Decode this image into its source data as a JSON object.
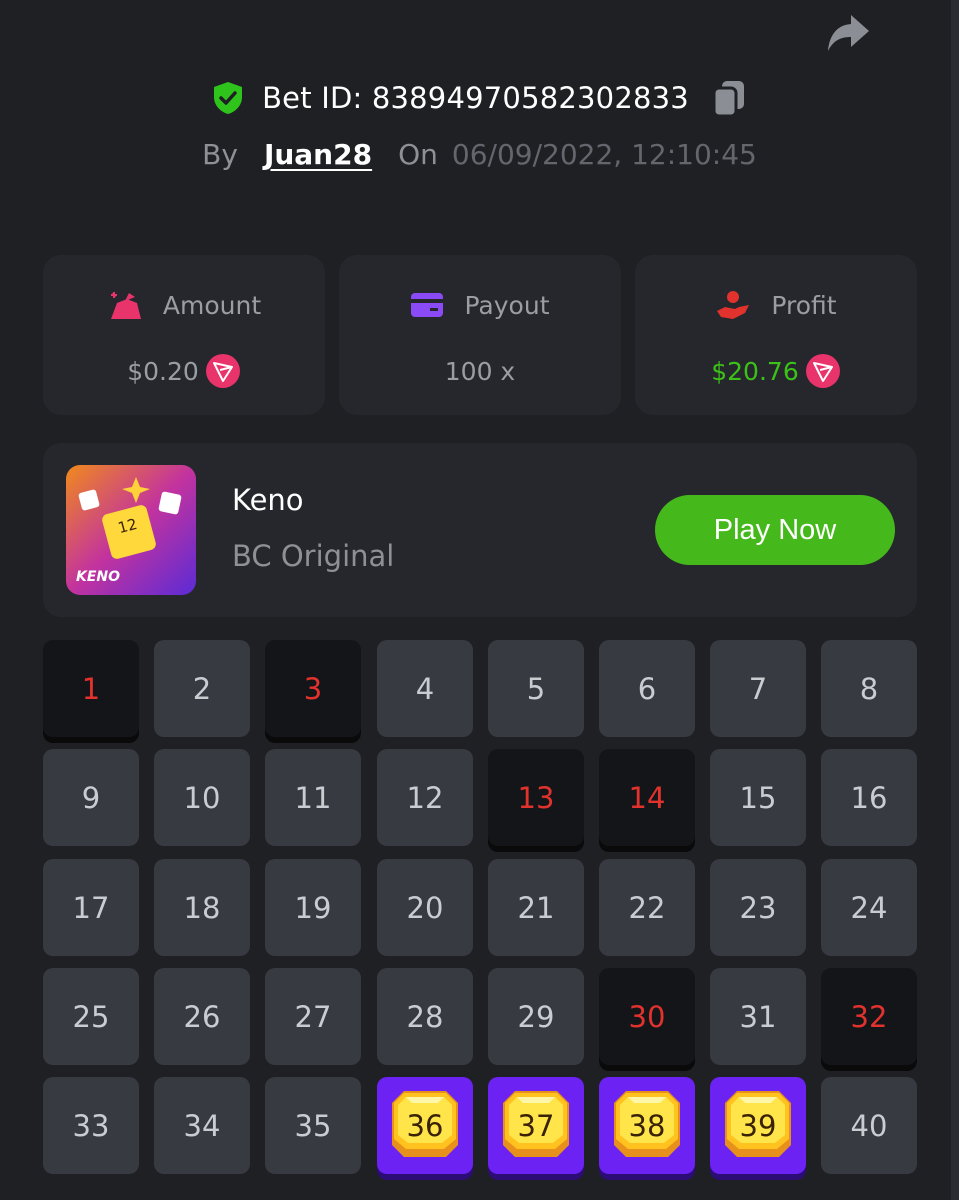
{
  "header": {
    "bet_id_label": "Bet ID: 838949705823028​33",
    "by_label": "By",
    "username": "Juan28",
    "on_label": "On",
    "datetime": "06/09/2022, 12:10:45"
  },
  "stats": [
    {
      "label": "Amount",
      "value": "$0.20",
      "icon": "money-bag-icon",
      "coin": "trx-coin-icon"
    },
    {
      "label": "Payout",
      "value": "100 x",
      "icon": "card-icon"
    },
    {
      "label": "Profit",
      "value": "$20.76",
      "icon": "hand-coin-icon",
      "coin": "trx-coin-icon"
    }
  ],
  "game": {
    "thumb_text": "KENO",
    "thumb_number": "12",
    "name": "Keno",
    "provider": "BC Original",
    "play_label": "Play Now"
  },
  "grid": {
    "numbers": [
      "1",
      "2",
      "3",
      "4",
      "5",
      "6",
      "7",
      "8",
      "9",
      "10",
      "11",
      "12",
      "13",
      "14",
      "15",
      "16",
      "17",
      "18",
      "19",
      "20",
      "21",
      "22",
      "23",
      "24",
      "25",
      "26",
      "27",
      "28",
      "29",
      "30",
      "31",
      "32",
      "33",
      "34",
      "35",
      "36",
      "37",
      "38",
      "39",
      "40"
    ],
    "states": [
      "miss",
      "normal",
      "miss",
      "normal",
      "normal",
      "normal",
      "normal",
      "normal",
      "normal",
      "normal",
      "normal",
      "normal",
      "miss",
      "miss",
      "normal",
      "normal",
      "normal",
      "normal",
      "normal",
      "normal",
      "normal",
      "normal",
      "normal",
      "normal",
      "normal",
      "normal",
      "normal",
      "normal",
      "normal",
      "miss",
      "normal",
      "miss",
      "normal",
      "normal",
      "normal",
      "hit",
      "hit",
      "hit",
      "hit",
      "normal"
    ]
  },
  "colors": {
    "accent_green": "#3bc117",
    "miss_red": "#e1322d",
    "hit_purple": "#6b22f3",
    "shield_green": "#2fc41c"
  }
}
